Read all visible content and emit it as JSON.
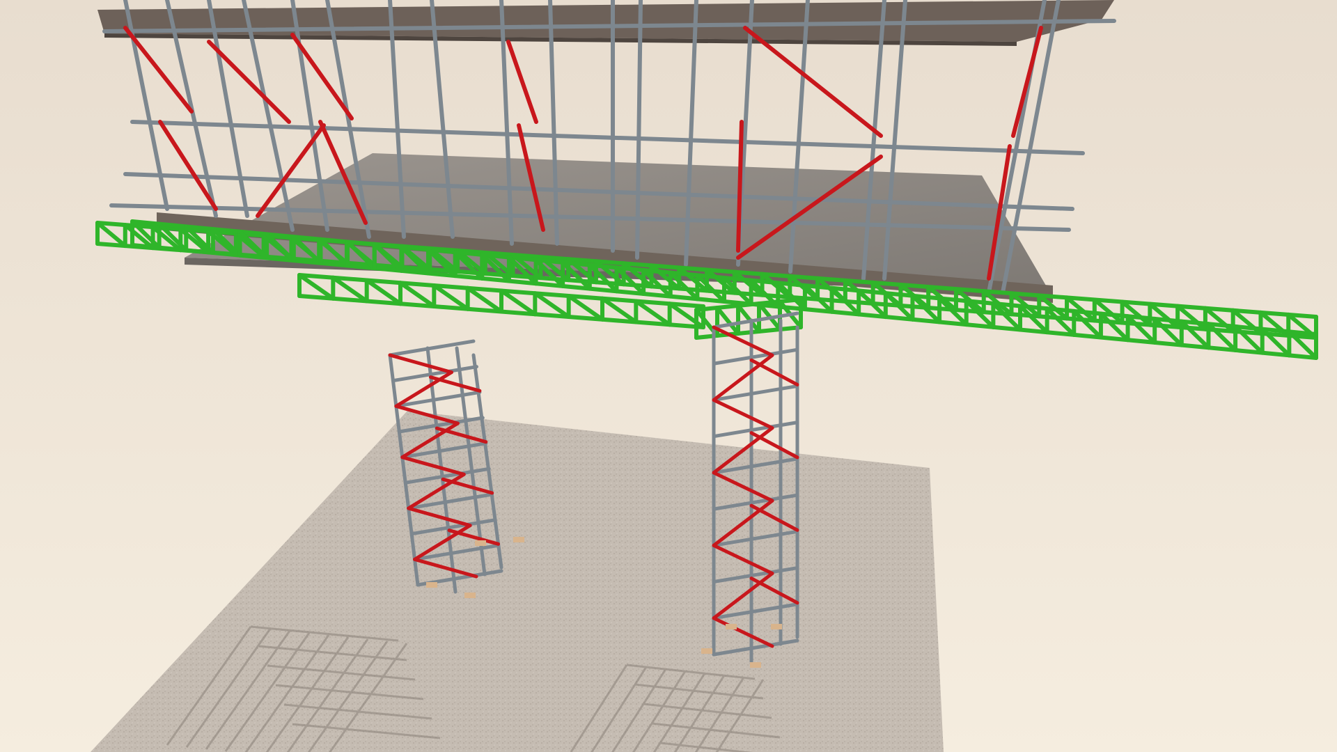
{
  "scene": {
    "description_visible_text": "",
    "elements": {
      "standard_tube_color": "#7d878f",
      "brace_color": "#c8171c",
      "truss_beam_color": "#2fb52a",
      "slab_color": "#8a8480",
      "deck_board_color": "#6e6258",
      "ground_color": "#c6bdb3",
      "base_plate_color": "#d9b48c",
      "background_top": "#e7dccd",
      "background_bottom": "#f4ecdd"
    }
  }
}
